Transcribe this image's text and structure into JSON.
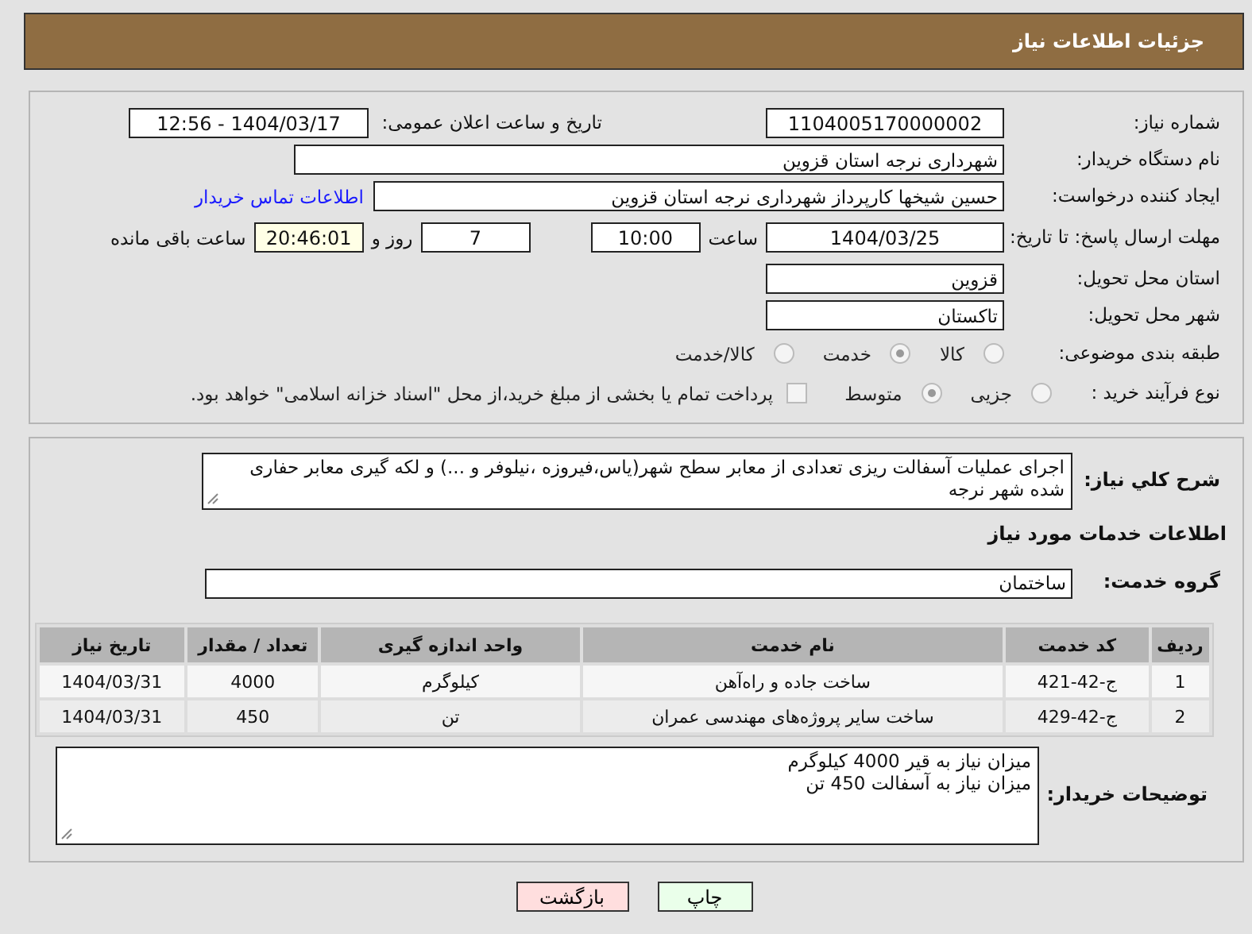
{
  "header": {
    "title": "جزئیات اطلاعات نیاز"
  },
  "need_number": {
    "label": "شماره نیاز:",
    "value": "1104005170000002"
  },
  "announce": {
    "label": "تاریخ و ساعت اعلان عمومی:",
    "value": "1404/03/17 - 12:56"
  },
  "buyer_org": {
    "label": "نام دستگاه خریدار:",
    "value": "شهرداری نرجه استان قزوین"
  },
  "requester": {
    "label": "ایجاد کننده درخواست:",
    "value": "حسین شیخها کارپرداز شهرداری نرجه استان قزوین",
    "link": "اطلاعات تماس خریدار"
  },
  "deadline": {
    "label": "مهلت ارسال پاسخ: تا تاریخ:",
    "date": "1404/03/25",
    "time_label": "ساعت",
    "time": "10:00",
    "days": "7",
    "days_label": "روز و",
    "remaining": "20:46:01",
    "remaining_label": "ساعت باقی مانده"
  },
  "province": {
    "label": "استان محل تحویل:",
    "value": "قزوین"
  },
  "city": {
    "label": "شهر محل تحویل:",
    "value": "تاکستان"
  },
  "category": {
    "label": "طبقه بندی موضوعی:",
    "options": [
      {
        "label": "کالا",
        "selected": false
      },
      {
        "label": "خدمت",
        "selected": true
      },
      {
        "label": "کالا/خدمت",
        "selected": false
      }
    ]
  },
  "process": {
    "label": "نوع فرآیند خرید :",
    "options": [
      {
        "label": "جزیی",
        "selected": false
      },
      {
        "label": "متوسط",
        "selected": true
      }
    ],
    "payment": {
      "label": "پرداخت تمام یا بخشی از مبلغ خرید،از محل \"اسناد خزانه اسلامی\" خواهد بود.",
      "checked": false
    }
  },
  "description": {
    "label": "شرح کلي نياز:",
    "value": "اجرای عملیات آسفالت ریزی تعدادی از معابر سطح شهر(یاس،فیروزه ،نیلوفر و ...) و لکه گیری معابر حفاری شده شهر نرجه"
  },
  "services_title": "اطلاعات خدمات مورد نیاز",
  "service_group": {
    "label": "گروه خدمت:",
    "value": "ساختمان"
  },
  "table": {
    "columns": [
      "ردیف",
      "کد خدمت",
      "نام خدمت",
      "واحد اندازه گیری",
      "تعداد / مقدار",
      "تاریخ نیاز"
    ],
    "rows": [
      [
        "1",
        "ج-42-421",
        "ساخت جاده و راه‌آهن",
        "کیلوگرم",
        "4000",
        "1404/03/31"
      ],
      [
        "2",
        "ج-42-429",
        "ساخت سایر پروژه‌های مهندسی عمران",
        "تن",
        "450",
        "1404/03/31"
      ]
    ]
  },
  "notes": {
    "label": "توضیحات خریدار:",
    "lines": [
      "میزان نیاز به قیر 4000 کیلوگرم",
      "میزان نیاز به آسفالت 450 تن"
    ]
  },
  "buttons": [
    {
      "label": "چاپ",
      "kind": "print"
    },
    {
      "label": "بازگشت",
      "kind": "back"
    }
  ]
}
